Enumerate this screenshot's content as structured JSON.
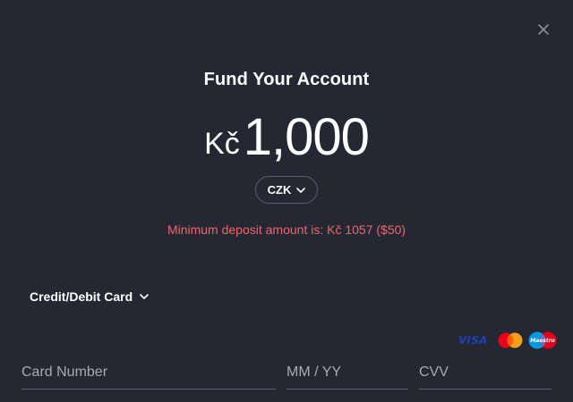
{
  "modal": {
    "close_label": "Close",
    "title": "Fund Your Account"
  },
  "amount": {
    "symbol": "Kč",
    "value": "1,000"
  },
  "currency": {
    "selected": "CZK"
  },
  "messages": {
    "minimum_deposit": "Minimum deposit amount is: Kč 1057 ($50)"
  },
  "payment_method": {
    "selected": "Credit/Debit Card"
  },
  "card_logos": {
    "visa_text": "VISA",
    "maestro_text": "Maestro"
  },
  "fields": {
    "card_number_placeholder": "Card Number",
    "expiry_placeholder": "MM / YY",
    "cvv_placeholder": "CVV"
  },
  "colors": {
    "background": "#252833",
    "text": "#ffffff",
    "error": "#f0646c",
    "border": "#5b5f6c",
    "placeholder": "#a7aab3"
  }
}
